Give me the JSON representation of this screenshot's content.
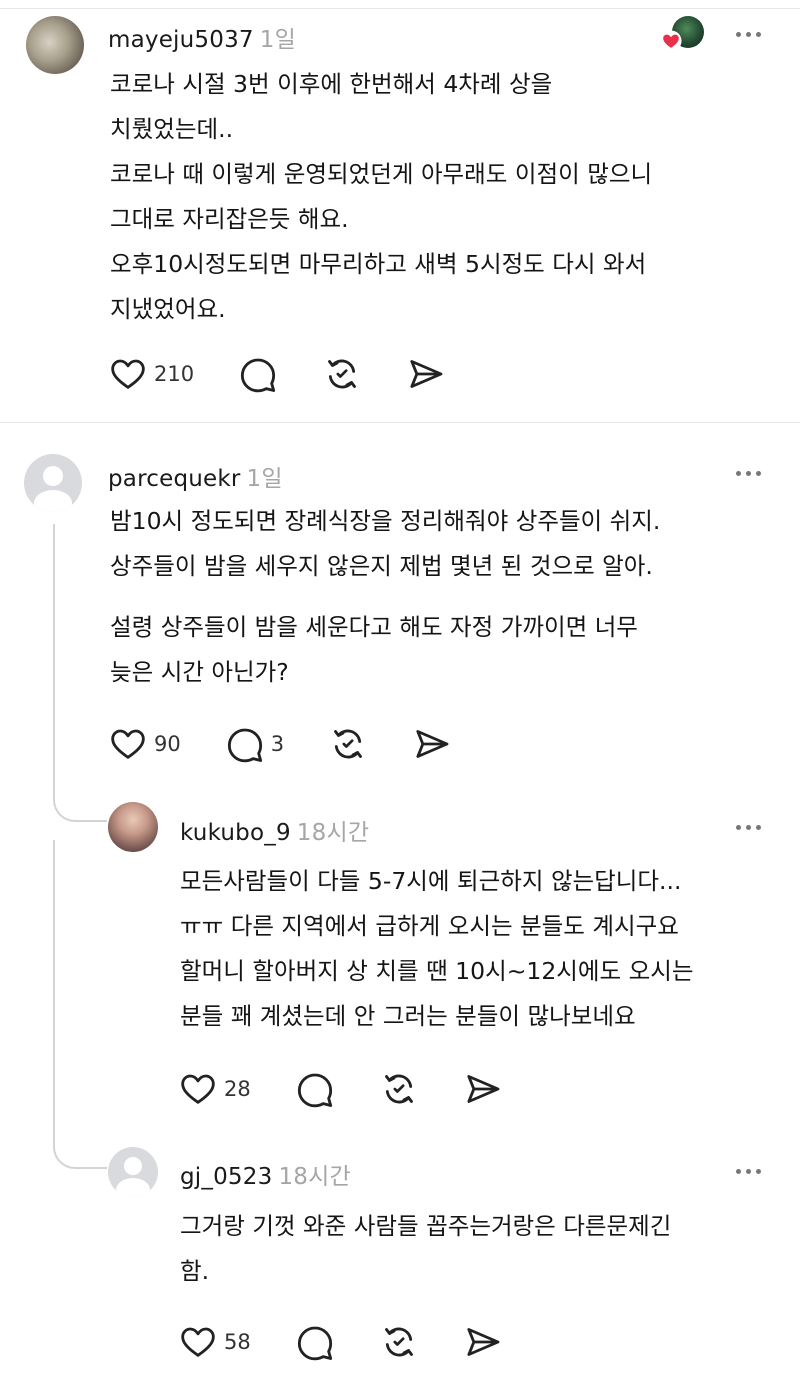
{
  "comments": [
    {
      "username": "mayeju5037",
      "time": "1일",
      "lines": [
        "코로나 시절  3번 이후에 한번해서 4차례 상을",
        "치뤘었는데..",
        "코로나 때 이렇게 운영되었던게 아무래도 이점이 많으니",
        "그대로 자리잡은듯 해요.",
        "오후10시정도되면 마무리하고 새벽 5시정도 다시 와서",
        "지냈었어요."
      ],
      "likes": "210",
      "replies": ""
    },
    {
      "username": "parcequekr",
      "time": "1일",
      "paragraph1": [
        "밤10시 정도되면 장례식장을 정리해줘야 상주들이 쉬지.",
        "상주들이 밤을 세우지 않은지 제법 몇년 된 것으로 알아."
      ],
      "paragraph2": [
        "설령 상주들이 밤을 세운다고 해도 자정 가까이면 너무",
        "늦은 시간 아닌가?"
      ],
      "likes": "90",
      "replies": "3"
    },
    {
      "username": "kukubo_9",
      "time": "18시간",
      "lines": [
        "모든사람들이 다들 5-7시에 퇴근하지 않는답니다...",
        "ㅠㅠ 다른 지역에서 급하게 오시는 분들도 계시구요",
        "할머니 할아버지 상 치를 땐 10시~12시에도 오시는",
        "분들 꽤 계셨는데 안 그러는 분들이 많나보네요"
      ],
      "likes": "28",
      "replies": ""
    },
    {
      "username": "gj_0523",
      "time": "18시간",
      "lines": [
        "그거랑 기껏 와준 사람들 꼽주는거랑은 다른문제긴",
        "함."
      ],
      "likes": "58",
      "replies": ""
    }
  ],
  "icons": {
    "like": "heart-outline-icon",
    "reply": "speech-bubble-icon",
    "repost": "repost-arrows-icon",
    "share": "send-arrow-icon",
    "more": "more-dots-icon"
  },
  "colors": {
    "accent_like": "#e8304a",
    "muted": "#a6a6a6",
    "divider": "#e6e6e6"
  }
}
